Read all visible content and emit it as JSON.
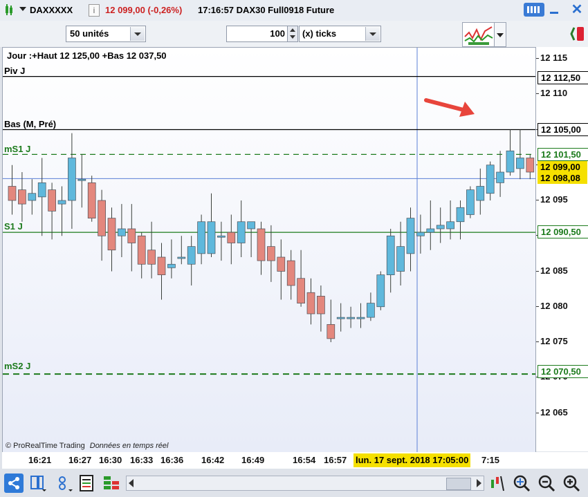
{
  "title": {
    "symbol": "DAXXXXX",
    "info_icon": "i",
    "price_change": "12 099,00 (-0,26%)",
    "time_and_name": "17:16:57 DAX30 Full0918 Future"
  },
  "toolbar": {
    "units_select": "50 unités",
    "ticks_value": "100",
    "ticks_select": "(x) ticks"
  },
  "chart": {
    "day_info": "Jour :+Haut 12 125,00 +Bas 12 037,50",
    "copyright": "© ProRealTime Trading",
    "realtime": "Données en temps réel",
    "crosshair_date": "lun. 17 sept. 2018 17:05:00",
    "line_labels": {
      "piv": "Piv J",
      "bas": "Bas (M, Pré)",
      "ms1": "mS1 J",
      "s1": "S1 J",
      "ms2": "mS2 J"
    }
  },
  "price_tags": {
    "piv": "12 112,50",
    "bas": "12 105,00",
    "ms1": "12 101,50",
    "last": "12 099,00",
    "cross": "12 098,08",
    "s1": "12 090,50",
    "ms2": "12 070,50"
  },
  "colors": {
    "up": "#5fb8dc",
    "down": "#e3877d",
    "support": "#1b7a1b",
    "accent": "#f5e000"
  },
  "chart_data": {
    "type": "candlestick",
    "y_ticks": [
      "12 115",
      "12 110",
      "12 105",
      "12 100",
      "12 095",
      "12 090",
      "12 085",
      "12 080",
      "12 075",
      "12 070",
      "12 065"
    ],
    "x_ticks": [
      "16:21",
      "16:27",
      "16:30",
      "16:33",
      "16:36",
      "16:42",
      "16:49",
      "16:54",
      "16:57",
      "7:15"
    ],
    "ylim": [
      12062,
      12118
    ],
    "lines": [
      {
        "name": "Piv J",
        "value": 12112.5,
        "style": "solid",
        "color": "#000000"
      },
      {
        "name": "Bas (M, Pré)",
        "value": 12105.0,
        "style": "solid",
        "color": "#000000"
      },
      {
        "name": "mS1 J",
        "value": 12101.5,
        "style": "dashed",
        "color": "#1b7a1b"
      },
      {
        "name": "S1 J",
        "value": 12090.5,
        "style": "solid",
        "color": "#1b7a1b"
      },
      {
        "name": "mS2 J",
        "value": 12070.5,
        "style": "dashed",
        "color": "#1b7a1b"
      }
    ],
    "candles": [
      {
        "o": 12097.0,
        "h": 12100.0,
        "l": 12093.0,
        "c": 12095.0
      },
      {
        "o": 12096.5,
        "h": 12099.0,
        "l": 12092.0,
        "c": 12094.5
      },
      {
        "o": 12095.0,
        "h": 12098.0,
        "l": 12093.0,
        "c": 12096.0
      },
      {
        "o": 12095.5,
        "h": 12101.0,
        "l": 12090.0,
        "c": 12097.5
      },
      {
        "o": 12096.5,
        "h": 12097.5,
        "l": 12089.5,
        "c": 12093.5
      },
      {
        "o": 12094.5,
        "h": 12097.0,
        "l": 12090.0,
        "c": 12095.0
      },
      {
        "o": 12095.0,
        "h": 12104.5,
        "l": 12091.0,
        "c": 12101.0
      },
      {
        "o": 12098.0,
        "h": 12101.5,
        "l": 12094.0,
        "c": 12098.0
      },
      {
        "o": 12097.5,
        "h": 12098.5,
        "l": 12092.0,
        "c": 12092.5
      },
      {
        "o": 12095.0,
        "h": 12096.5,
        "l": 12086.5,
        "c": 12090.0
      },
      {
        "o": 12092.5,
        "h": 12094.0,
        "l": 12085.0,
        "c": 12088.0
      },
      {
        "o": 12090.0,
        "h": 12094.5,
        "l": 12087.0,
        "c": 12091.0
      },
      {
        "o": 12091.0,
        "h": 12094.5,
        "l": 12085.0,
        "c": 12089.0
      },
      {
        "o": 12090.0,
        "h": 12090.5,
        "l": 12084.0,
        "c": 12086.0
      },
      {
        "o": 12088.0,
        "h": 12092.0,
        "l": 12084.0,
        "c": 12086.0
      },
      {
        "o": 12087.0,
        "h": 12089.0,
        "l": 12081.0,
        "c": 12084.5
      },
      {
        "o": 12085.5,
        "h": 12089.5,
        "l": 12084.0,
        "c": 12086.0
      },
      {
        "o": 12087.0,
        "h": 12090.0,
        "l": 12086.0,
        "c": 12087.0
      },
      {
        "o": 12086.0,
        "h": 12090.0,
        "l": 12083.0,
        "c": 12088.5
      },
      {
        "o": 12087.5,
        "h": 12093.0,
        "l": 12086.0,
        "c": 12092.0
      },
      {
        "o": 12087.5,
        "h": 12096.0,
        "l": 12087.0,
        "c": 12092.0
      },
      {
        "o": 12090.0,
        "h": 12092.0,
        "l": 12086.5,
        "c": 12090.0
      },
      {
        "o": 12090.5,
        "h": 12093.0,
        "l": 12086.0,
        "c": 12089.0
      },
      {
        "o": 12089.0,
        "h": 12095.0,
        "l": 12087.0,
        "c": 12092.0
      },
      {
        "o": 12091.0,
        "h": 12092.0,
        "l": 12087.0,
        "c": 12092.0
      },
      {
        "o": 12091.0,
        "h": 12092.0,
        "l": 12084.5,
        "c": 12086.5
      },
      {
        "o": 12088.5,
        "h": 12091.5,
        "l": 12083.5,
        "c": 12086.5
      },
      {
        "o": 12087.0,
        "h": 12089.5,
        "l": 12081.0,
        "c": 12085.0
      },
      {
        "o": 12086.5,
        "h": 12088.0,
        "l": 12081.0,
        "c": 12083.0
      },
      {
        "o": 12084.0,
        "h": 12088.0,
        "l": 12080.0,
        "c": 12080.5
      },
      {
        "o": 12082.0,
        "h": 12084.0,
        "l": 12077.5,
        "c": 12079.0
      },
      {
        "o": 12081.5,
        "h": 12083.0,
        "l": 12076.5,
        "c": 12079.0
      },
      {
        "o": 12077.5,
        "h": 12081.0,
        "l": 12075.0,
        "c": 12075.5
      },
      {
        "o": 12078.5,
        "h": 12080.5,
        "l": 12076.5,
        "c": 12078.5
      },
      {
        "o": 12078.5,
        "h": 12080.0,
        "l": 12077.0,
        "c": 12078.5
      },
      {
        "o": 12078.5,
        "h": 12080.5,
        "l": 12077.0,
        "c": 12078.5
      },
      {
        "o": 12078.5,
        "h": 12082.0,
        "l": 12078.0,
        "c": 12080.5
      },
      {
        "o": 12080.0,
        "h": 12085.0,
        "l": 12079.5,
        "c": 12084.5
      },
      {
        "o": 12084.5,
        "h": 12091.0,
        "l": 12082.0,
        "c": 12090.0
      },
      {
        "o": 12085.0,
        "h": 12092.0,
        "l": 12083.0,
        "c": 12088.5
      },
      {
        "o": 12087.5,
        "h": 12094.0,
        "l": 12085.0,
        "c": 12092.5
      },
      {
        "o": 12090.0,
        "h": 12093.0,
        "l": 12087.5,
        "c": 12090.5
      },
      {
        "o": 12090.5,
        "h": 12095.0,
        "l": 12088.0,
        "c": 12091.0
      },
      {
        "o": 12091.0,
        "h": 12094.0,
        "l": 12089.0,
        "c": 12091.5
      },
      {
        "o": 12091.0,
        "h": 12095.0,
        "l": 12089.5,
        "c": 12092.0
      },
      {
        "o": 12092.0,
        "h": 12095.0,
        "l": 12089.5,
        "c": 12094.0
      },
      {
        "o": 12093.0,
        "h": 12097.0,
        "l": 12092.5,
        "c": 12096.5
      },
      {
        "o": 12095.0,
        "h": 12099.5,
        "l": 12093.0,
        "c": 12097.0
      },
      {
        "o": 12096.0,
        "h": 12100.5,
        "l": 12095.0,
        "c": 12100.0
      },
      {
        "o": 12097.5,
        "h": 12102.0,
        "l": 12095.5,
        "c": 12099.0
      },
      {
        "o": 12099.0,
        "h": 12105.0,
        "l": 12098.5,
        "c": 12102.0
      },
      {
        "o": 12099.5,
        "h": 12105.0,
        "l": 12098.0,
        "c": 12101.0
      },
      {
        "o": 12101.0,
        "h": 12101.5,
        "l": 12098.0,
        "c": 12099.0
      }
    ]
  }
}
